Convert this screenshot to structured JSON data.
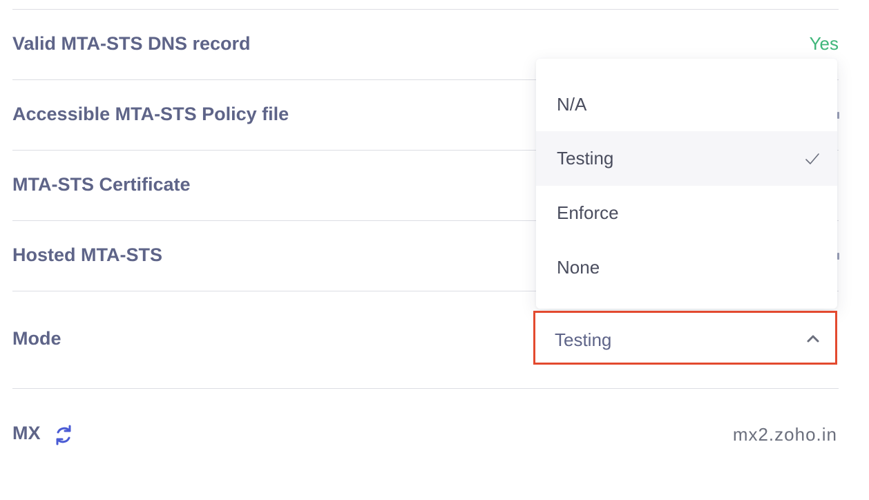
{
  "rows": [
    {
      "label": "Valid MTA-STS DNS record",
      "value": "Yes"
    },
    {
      "label": "Accessible MTA-STS Policy file"
    },
    {
      "label": "MTA-STS Certificate"
    },
    {
      "label": "Hosted MTA-STS"
    },
    {
      "label": "Mode"
    },
    {
      "label": "MX",
      "value": "mx2.zoho.in"
    }
  ],
  "mode_select": {
    "value": "Testing",
    "expanded": true,
    "options": [
      {
        "label": "N/A",
        "selected": false
      },
      {
        "label": "Testing",
        "selected": true
      },
      {
        "label": "Enforce",
        "selected": false
      },
      {
        "label": "None",
        "selected": false
      }
    ]
  },
  "icons": {
    "refresh": "refresh-icon",
    "check": "check-icon",
    "chevron": "chevron-up-icon"
  },
  "colors": {
    "label": "#5e6488",
    "yes": "#3fb67a",
    "highlight_border": "#e34a2f",
    "accent_icon": "#4a5bd4"
  }
}
